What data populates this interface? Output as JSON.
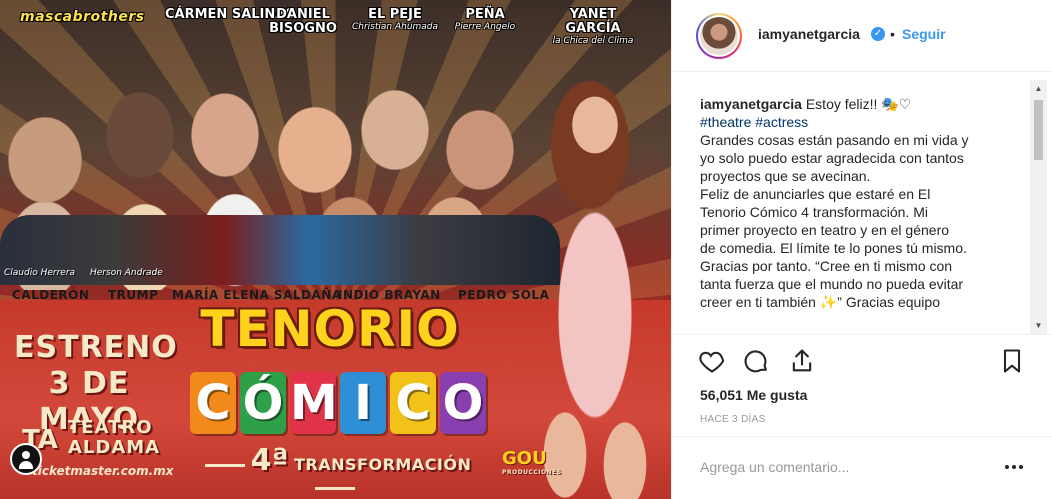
{
  "poster": {
    "brand": "mascabrothers",
    "top_cast": [
      {
        "name": "CÁRMEN SALINAS",
        "sub": ""
      },
      {
        "name": "DANIEL BISOGNO",
        "sub": ""
      },
      {
        "name": "EL PEJE",
        "sub": "Christian Ahumada"
      },
      {
        "name": "PEÑA",
        "sub": "Pierre Angelo"
      },
      {
        "name": "YANET GARCÍA",
        "sub": "la Chica del Clima"
      }
    ],
    "small_names": [
      "Claudio Herrera",
      "Herson Andrade"
    ],
    "roles": [
      "CALDERÓN",
      "TRUMP",
      "MARÍA ELENA SALDAÑA",
      "INDIO BRAYAN",
      "PEDRO SOLA"
    ],
    "estreno": "ESTRENO",
    "date": "3 DE MAYO",
    "ta": "TA",
    "teatro": "TEATRO",
    "aldama": "ALDAMA",
    "ticket": "ticketmaster.com.mx",
    "title_top": "TENORIO",
    "title_letters": [
      {
        "ch": "C",
        "color": "#f28a1b"
      },
      {
        "ch": "Ó",
        "color": "#2fa04a"
      },
      {
        "ch": "M",
        "color": "#e0334a"
      },
      {
        "ch": "I",
        "color": "#2f8fd6"
      },
      {
        "ch": "C",
        "color": "#f2c21b"
      },
      {
        "ch": "O",
        "color": "#8a3fb0"
      }
    ],
    "edition_number": "4ª",
    "edition_word": "TRANSFORMACIÓN",
    "producer": "GOU",
    "producer_sub": "PRODUCCIONES"
  },
  "post": {
    "username": "iamyanetgarcia",
    "verified_icon": "check-icon",
    "separator": "•",
    "follow_label": "Seguir",
    "caption_user": "iamyanetgarcia",
    "caption_lines": [
      "Estoy feliz!! 🎭♡",
      "#theatre #actress",
      "Grandes cosas están pasando en mi vida y",
      "yo solo puedo estar agradecida con tantos",
      "proyectos que se avecinan.",
      "Feliz de anunciarles que estaré en El",
      "Tenorio Cómico 4 transformación. Mi",
      "primer proyecto en teatro y en el género",
      "de comedia. El límite te lo pones tú mismo.",
      "Gracias por tanto. “Cree en ti mismo con",
      "tanta fuerza que el mundo no pueda evitar",
      "creer en ti también ✨” Gracias equipo"
    ],
    "likes": "56,051 Me gusta",
    "time": "HACE 3 DÍAS",
    "comment_placeholder": "Agrega un comentario...",
    "accent_color": "#3897f0"
  }
}
